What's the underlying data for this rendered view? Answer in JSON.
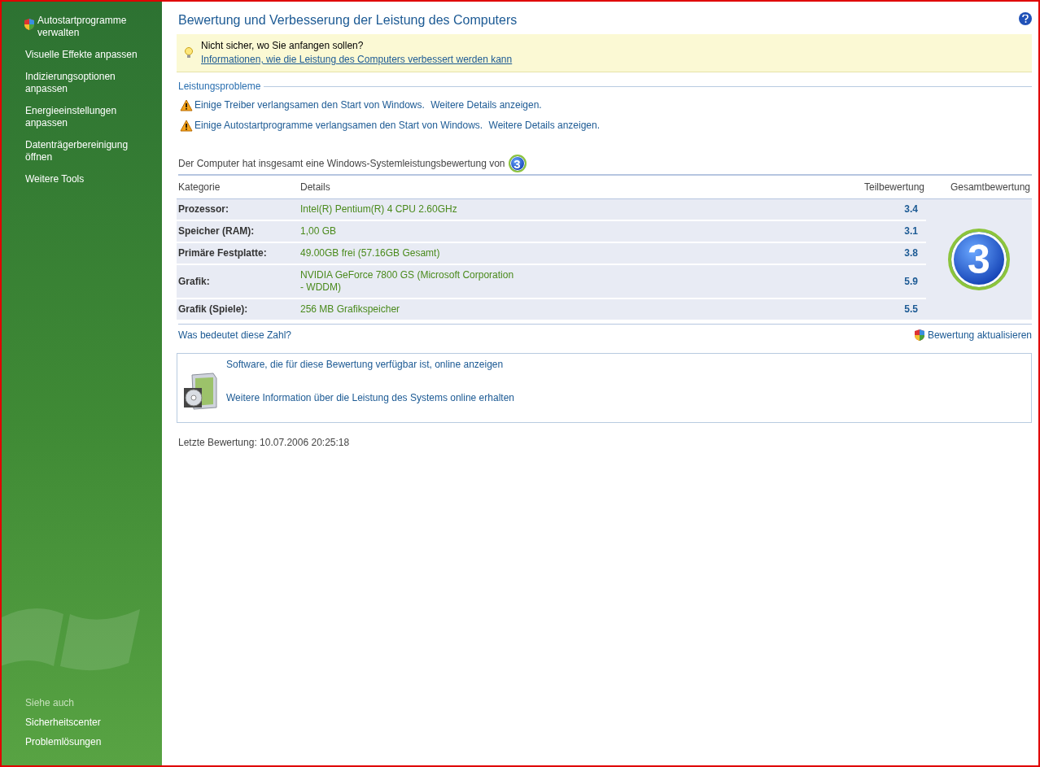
{
  "sidebar": {
    "tasks": [
      {
        "label": "Autostartprogramme verwalten",
        "kind": "shield"
      },
      {
        "label": "Visuelle Effekte anpassen",
        "kind": "plain"
      },
      {
        "label": "Indizierungsoptionen anpassen",
        "kind": "plain"
      },
      {
        "label": "Energieeinstellungen anpassen",
        "kind": "plain"
      },
      {
        "label": "Datenträgerbereinigung öffnen",
        "kind": "plain"
      },
      {
        "label": "Weitere Tools",
        "kind": "plain"
      }
    ],
    "see_also": {
      "heading": "Siehe auch",
      "links": [
        "Sicherheitscenter",
        "Problemlösungen"
      ]
    }
  },
  "title": "Bewertung und Verbesserung der Leistung des Computers",
  "tip": {
    "heading": "Nicht sicher, wo Sie anfangen sollen?",
    "link": "Informationen, wie die Leistung des Computers verbessert werden kann"
  },
  "problems": {
    "heading": "Leistungsprobleme",
    "items": [
      {
        "text": "Einige Treiber verlangsamen den Start von Windows.",
        "link": "Weitere Details anzeigen."
      },
      {
        "text": "Einige Autostartprogramme verlangsamen den Start von Windows.",
        "link": "Weitere Details anzeigen."
      }
    ]
  },
  "summary": {
    "text": "Der Computer hat insgesamt eine Windows-Systemleistungsbewertung von",
    "score": "3"
  },
  "table": {
    "columns": [
      "Kategorie",
      "Details",
      "Teilbewertung",
      "Gesamtbewertung"
    ],
    "rows": [
      {
        "category": "Prozessor:",
        "details": "Intel(R) Pentium(R) 4 CPU 2.60GHz",
        "subscore": "3.4"
      },
      {
        "category": "Speicher (RAM):",
        "details": "1,00 GB",
        "subscore": "3.1"
      },
      {
        "category": "Primäre Festplatte:",
        "details": "49.00GB frei (57.16GB Gesamt)",
        "subscore": "3.8"
      },
      {
        "category": "Grafik:",
        "details": "NVIDIA GeForce 7800 GS (Microsoft Corporation - WDDM)",
        "subscore": "5.9"
      },
      {
        "category": "Grafik (Spiele):",
        "details": "256 MB Grafikspeicher",
        "subscore": "5.5"
      }
    ],
    "overall": "3"
  },
  "what_link": "Was bedeutet diese Zahl?",
  "refresh_link": "Bewertung aktualisieren",
  "online": {
    "links": [
      "Software, die für diese Bewertung verfügbar ist, online anzeigen",
      "Weitere Information über die Leistung des Systems online erhalten"
    ]
  },
  "last_rating": "Letzte Bewertung: 10.07.2006 20:25:18"
}
